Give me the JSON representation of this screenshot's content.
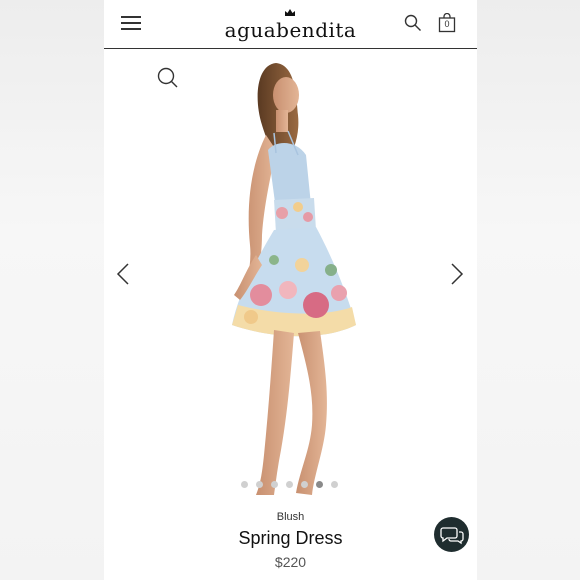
{
  "header": {
    "logo_text": "aguabendita",
    "cart_count": "0"
  },
  "gallery": {
    "total_images": 7,
    "active_index": 5
  },
  "product": {
    "color": "Blush",
    "name": "Spring Dress",
    "price": "$220"
  },
  "colors": {
    "accent": "#1f2d2f",
    "dot_inactive": "#d0d0d0",
    "dot_active": "#8a8a8a"
  },
  "icons": [
    "menu-icon",
    "crown-icon",
    "search-icon",
    "shopping-bag-icon",
    "zoom-icon",
    "chevron-left-icon",
    "chevron-right-icon",
    "chat-icon"
  ]
}
